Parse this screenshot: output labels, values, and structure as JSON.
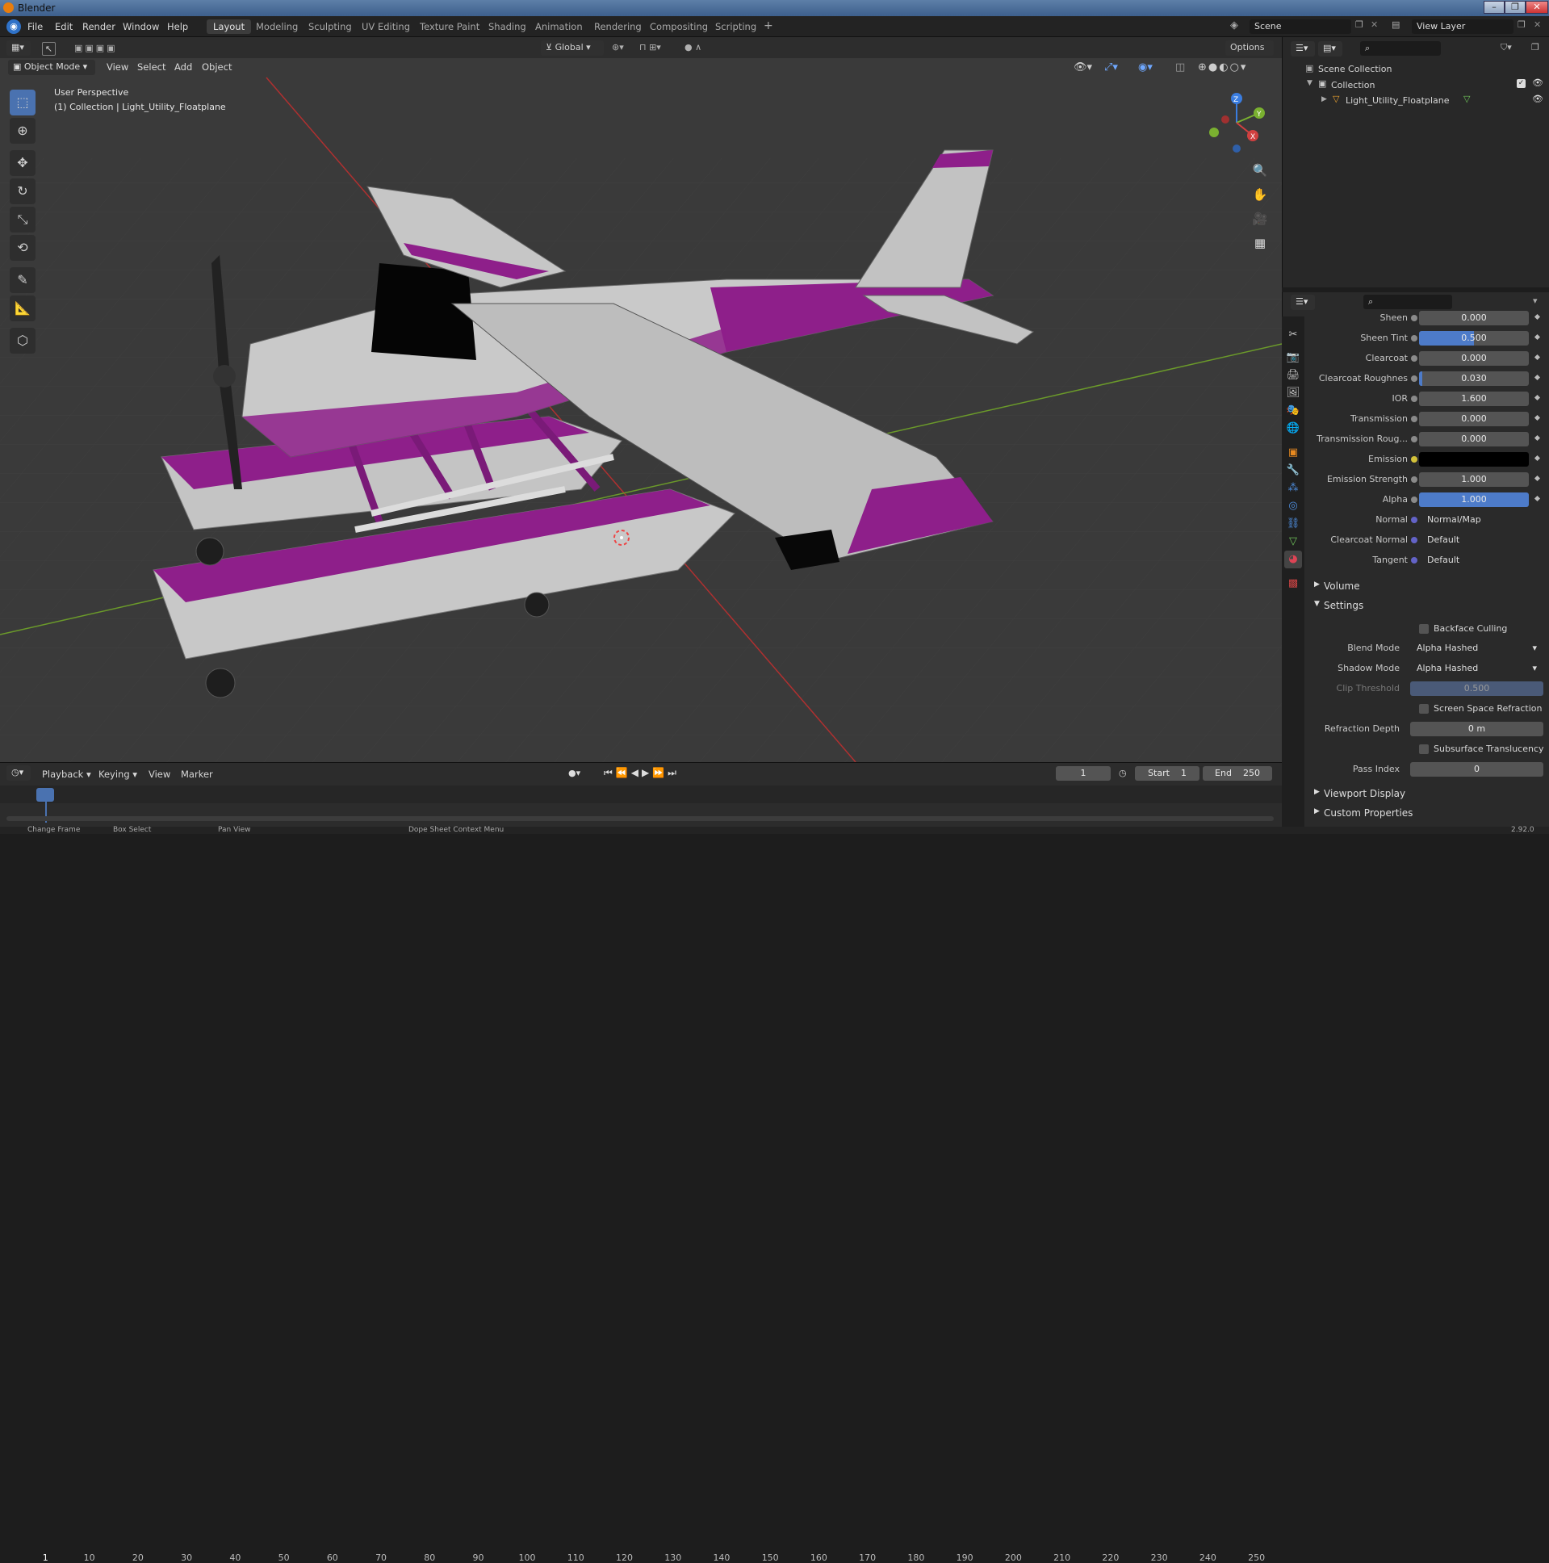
{
  "window": {
    "title": "Blender",
    "controls": [
      "–",
      "❐",
      "✕"
    ]
  },
  "menus": [
    "File",
    "Edit",
    "Render",
    "Window",
    "Help"
  ],
  "workspaces": [
    "Layout",
    "Modeling",
    "Sculpting",
    "UV Editing",
    "Texture Paint",
    "Shading",
    "Animation",
    "Rendering",
    "Compositing",
    "Scripting"
  ],
  "active_workspace": "Layout",
  "scene": {
    "name": "Scene",
    "view_layer": "View Layer"
  },
  "viewport": {
    "mode": "Object Mode",
    "menus": [
      "View",
      "Select",
      "Add",
      "Object"
    ],
    "transform": "Global",
    "options": "Options",
    "overlay_title": "User Perspective",
    "overlay_sub": "(1) Collection | Light_Utility_Floatplane",
    "gizmo": {
      "x": "X",
      "y": "Y",
      "z": "Z"
    }
  },
  "outliner": {
    "root": "Scene Collection",
    "collection": "Collection",
    "object": "Light_Utility_Floatplane"
  },
  "properties": {
    "rows": [
      {
        "label": "Sheen",
        "value": "0.000",
        "fill": 0
      },
      {
        "label": "Sheen Tint",
        "value": "0.500",
        "fill": 0.5
      },
      {
        "label": "Clearcoat",
        "value": "0.000",
        "fill": 0
      },
      {
        "label": "Clearcoat Roughnes",
        "value": "0.030",
        "fill": 0.03
      },
      {
        "label": "IOR",
        "value": "1.600",
        "fill": 0
      },
      {
        "label": "Transmission",
        "value": "0.000",
        "fill": 0
      },
      {
        "label": "Transmission Roug...",
        "value": "0.000",
        "fill": 0
      },
      {
        "label": "Emission",
        "value": "",
        "color": "#000000"
      },
      {
        "label": "Emission Strength",
        "value": "1.000",
        "fill": 0
      },
      {
        "label": "Alpha",
        "value": "1.000",
        "fill": 1
      },
      {
        "label": "Normal",
        "value": "Normal/Map",
        "link": true
      },
      {
        "label": "Clearcoat Normal",
        "value": "Default",
        "link": true
      },
      {
        "label": "Tangent",
        "value": "Default",
        "link": true
      }
    ],
    "sections": {
      "volume": "Volume",
      "settings": "Settings",
      "viewport_display": "Viewport Display",
      "custom_properties": "Custom Properties"
    },
    "settings": {
      "backface_culling": "Backface Culling",
      "blend_mode_label": "Blend Mode",
      "blend_mode": "Alpha Hashed",
      "shadow_mode_label": "Shadow Mode",
      "shadow_mode": "Alpha Hashed",
      "clip_threshold_label": "Clip Threshold",
      "clip_threshold": "0.500",
      "ssr": "Screen Space Refraction",
      "refraction_depth_label": "Refraction Depth",
      "refraction_depth": "0 m",
      "sss": "Subsurface Translucency",
      "pass_index_label": "Pass Index",
      "pass_index": "0"
    }
  },
  "timeline": {
    "menus": [
      "Playback",
      "Keying",
      "View",
      "Marker"
    ],
    "current_frame": "1",
    "start_label": "Start",
    "start": "1",
    "end_label": "End",
    "end": "250",
    "ticks": [
      "1",
      "10",
      "20",
      "30",
      "40",
      "50",
      "60",
      "70",
      "80",
      "90",
      "100",
      "110",
      "120",
      "130",
      "140",
      "150",
      "160",
      "170",
      "180",
      "190",
      "200",
      "210",
      "220",
      "230",
      "240",
      "250"
    ]
  },
  "statusbar": {
    "items": [
      "Change Frame",
      "Box Select",
      "Pan View",
      "Dope Sheet Context Menu"
    ],
    "version": "2.92.0"
  },
  "colors": {
    "accent": "#4a72b0",
    "plane_purple": "#8e1f8a",
    "plane_white": "#c8c8c8"
  }
}
